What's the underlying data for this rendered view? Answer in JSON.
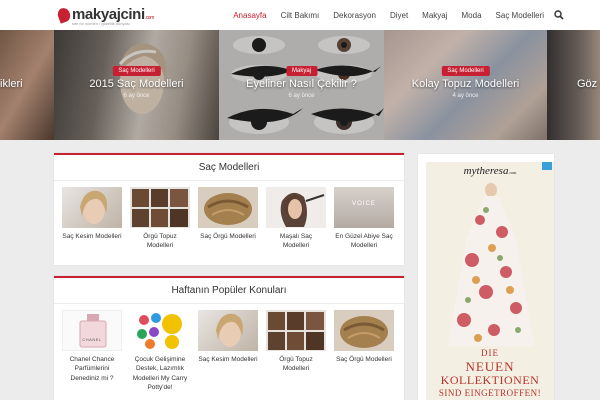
{
  "header": {
    "logo_main": "makyajcini",
    "logo_suffix": ".com",
    "logo_tagline": "site for women / güzellik dünyası",
    "nav": [
      "Anasayfa",
      "Cilt Bakımı",
      "Dekorasyon",
      "Diyet",
      "Makyaj",
      "Moda",
      "Saç Modelleri"
    ],
    "active_nav": "Anasayfa",
    "search_icon": "search-icon"
  },
  "slider": [
    {
      "title": "ikleri"
    },
    {
      "category": "Saç Modelleri",
      "title": "2015 Saç Modelleri",
      "ago": "6 ay önce"
    },
    {
      "category": "Makyaj",
      "title": "Eyeliner Nasıl Çekilir ?",
      "ago": "6 ay önce"
    },
    {
      "category": "Saç Modelleri",
      "title": "Kolay Topuz Modelleri",
      "ago": "4 ay önce"
    },
    {
      "title": "Göz M"
    }
  ],
  "section1": {
    "title": "Saç Modelleri",
    "items": [
      {
        "caption": "Saç Kesim Modelleri"
      },
      {
        "caption": "Örgü Topuz Modelleri"
      },
      {
        "caption": "Saç Örgü Modelleri"
      },
      {
        "caption": "Maşalı Saç Modelleri"
      },
      {
        "caption": "En Güzel Abiye Saç Modelleri",
        "thumb_text": "VOICE"
      }
    ]
  },
  "section2": {
    "title": "Haftanın Popüler Konuları",
    "items": [
      {
        "caption": "Chanel Chance Parfümlerini Denediniz mi ?",
        "thumb_text": "CHANEL"
      },
      {
        "caption": "Çocuk Gelişimine Destek, Lazımlık Modelleri My Carry Potty'de!"
      },
      {
        "caption": "Saç Kesim Modelleri"
      },
      {
        "caption": "Örgü Topuz Modelleri"
      },
      {
        "caption": "Saç Örgü Modelleri"
      }
    ]
  },
  "ad": {
    "brand": "mytheresa",
    "brand_domain": ".com",
    "line1": "DIE",
    "line2": "NEUEN",
    "line3": "KOLLEKTIONEN",
    "line4": "SIND EINGETROFFEN!"
  },
  "colors": {
    "accent": "#c62032",
    "ad_text": "#b8332a"
  }
}
